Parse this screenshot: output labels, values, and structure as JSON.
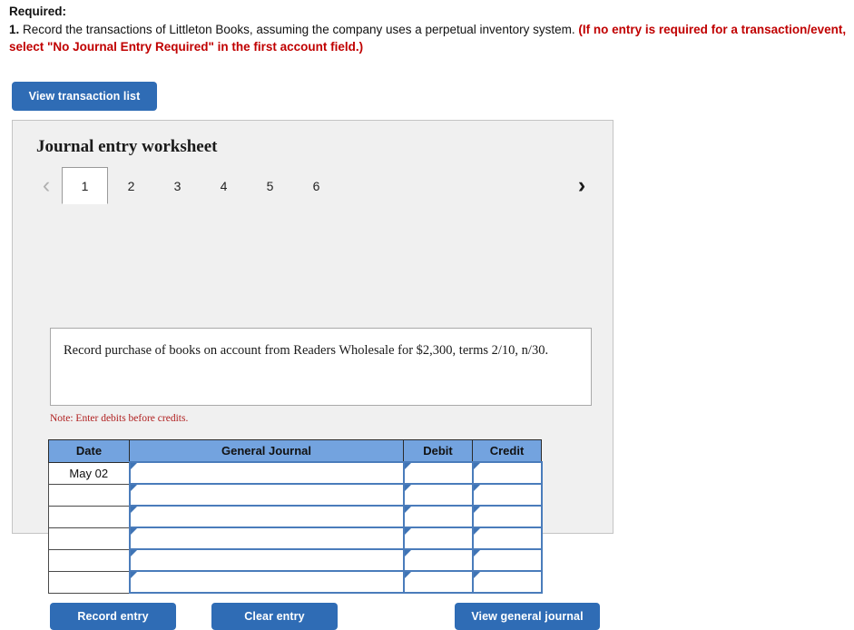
{
  "colors": {
    "button_blue": "#2f6cb5",
    "table_header_blue": "#73a3df",
    "panel_bg": "#f0f0f0",
    "note_red": "#b02020",
    "required_red": "#c00000",
    "cell_border_blue": "#4a7cbb"
  },
  "required": {
    "label": "Required:",
    "number": "1.",
    "text_black": " Record the transactions of Littleton Books, assuming the company uses a perpetual inventory system. ",
    "text_red": "(If no entry is required for a transaction/event, select \"No Journal Entry Required\" in the first account field.)"
  },
  "toolbar": {
    "view_transaction_list_label": "View transaction list"
  },
  "worksheet": {
    "title": "Journal entry worksheet",
    "prev_icon": "‹",
    "next_icon": "›",
    "tabs": [
      {
        "label": "1",
        "active": true
      },
      {
        "label": "2",
        "active": false
      },
      {
        "label": "3",
        "active": false
      },
      {
        "label": "4",
        "active": false
      },
      {
        "label": "5",
        "active": false
      },
      {
        "label": "6",
        "active": false
      }
    ],
    "description": "Record purchase of books on account from Readers Wholesale for $2,300, terms 2/10, n/30.",
    "note": "Note: Enter debits before credits."
  },
  "journal_table": {
    "headers": [
      "Date",
      "General Journal",
      "Debit",
      "Credit"
    ],
    "rows": [
      {
        "date": "May 02",
        "general_journal": "",
        "debit": "",
        "credit": ""
      },
      {
        "date": "",
        "general_journal": "",
        "debit": "",
        "credit": ""
      },
      {
        "date": "",
        "general_journal": "",
        "debit": "",
        "credit": ""
      },
      {
        "date": "",
        "general_journal": "",
        "debit": "",
        "credit": ""
      },
      {
        "date": "",
        "general_journal": "",
        "debit": "",
        "credit": ""
      },
      {
        "date": "",
        "general_journal": "",
        "debit": "",
        "credit": ""
      }
    ]
  },
  "actions": {
    "record_entry_label": "Record entry",
    "clear_entry_label": "Clear entry",
    "view_general_journal_label": "View general journal"
  }
}
